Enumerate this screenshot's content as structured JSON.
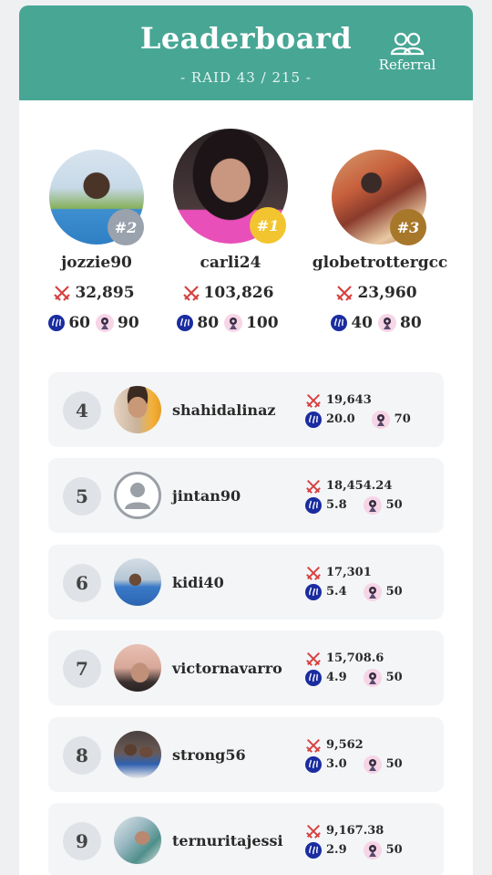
{
  "header": {
    "title": "Leaderboard",
    "subtitle": "- RAID 43 / 215 -",
    "referral_label": "Referral"
  },
  "colors": {
    "header_bg": "#48a695",
    "gold": "#f2c530",
    "silver": "#9aa2ad",
    "bronze": "#a7772a",
    "steem_blue": "#1a2ca0"
  },
  "podium": [
    {
      "rank": "#1",
      "name": "carli24",
      "damage": "103,826",
      "steem": "80",
      "units": "100"
    },
    {
      "rank": "#2",
      "name": "jozzie90",
      "damage": "32,895",
      "steem": "60",
      "units": "90"
    },
    {
      "rank": "#3",
      "name": "globetrottergcc",
      "damage": "23,960",
      "steem": "40",
      "units": "80"
    }
  ],
  "rows": [
    {
      "rank": "4",
      "name": "shahidalinaz",
      "damage": "19,643",
      "steem": "20.0",
      "units": "70"
    },
    {
      "rank": "5",
      "name": "jintan90",
      "damage": "18,454.24",
      "steem": "5.8",
      "units": "50"
    },
    {
      "rank": "6",
      "name": "kidi40",
      "damage": "17,301",
      "steem": "5.4",
      "units": "50"
    },
    {
      "rank": "7",
      "name": "victornavarro",
      "damage": "15,708.6",
      "steem": "4.9",
      "units": "50"
    },
    {
      "rank": "8",
      "name": "strong56",
      "damage": "9,562",
      "steem": "3.0",
      "units": "50"
    },
    {
      "rank": "9",
      "name": "ternuritajessi",
      "damage": "9,167.38",
      "steem": "2.9",
      "units": "50"
    }
  ]
}
